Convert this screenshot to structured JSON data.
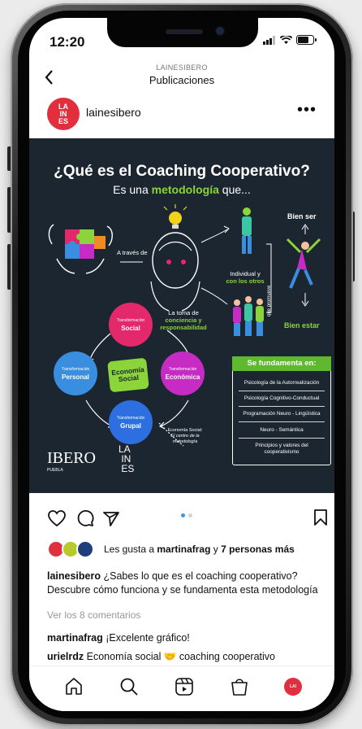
{
  "status": {
    "time": "12:20"
  },
  "nav": {
    "back_icon": "chevron-left-icon",
    "account": "LAINESIBERO",
    "title": "Publicaciones"
  },
  "post": {
    "avatar_text": "LA IN ES",
    "username": "lainesibero",
    "more_icon": "more-horizontal-icon"
  },
  "graphic": {
    "title": "¿Qué es el Coaching Cooperativo?",
    "subtitle_pre": "Es una ",
    "subtitle_highlight": "metodología",
    "subtitle_post": " que...",
    "a_traves": "A través de",
    "toma_1": "La toma de",
    "toma_2": "conciencia y",
    "toma_3": "responsabilidad",
    "individual": "Individual y",
    "con_otros": "con los otros",
    "promueve": "que promueve",
    "bien_ser": "Bien ser",
    "bien_estar": "Bien estar",
    "circles": {
      "social": {
        "pre": "Transformación",
        "main": "Social"
      },
      "personal": {
        "pre": "Transformación",
        "main": "Personal"
      },
      "economica": {
        "pre": "Transformación",
        "main": "Económica"
      },
      "grupal": {
        "pre": "Transformación",
        "main": "Grupal"
      },
      "economia": "Economía Social"
    },
    "eco_note_1": "Economía Social:",
    "eco_note_2": "El centro de la",
    "eco_note_3": "metodología",
    "fundamenta": "Se fundamenta en:",
    "fund_items": [
      "Psicología de la Autorrealización",
      "Psicología Cognitivo-Conductual",
      "Programación Neuro - Lingüística",
      "Neuro - Semántica",
      "Principios y valores del cooperativismo"
    ],
    "ibero": "IBERO",
    "puebla": "PUEBLA",
    "laines_logo": "LA IN ES",
    "colors": {
      "bg": "#1c2631",
      "green": "#8bd43a",
      "pink": "#e3286b",
      "blue": "#3a8ee0",
      "magenta": "#c62bc4",
      "bright_blue": "#2d6fe0"
    }
  },
  "actions": {
    "like_icon": "heart-icon",
    "comment_icon": "comment-icon",
    "share_icon": "send-icon",
    "save_icon": "bookmark-icon"
  },
  "likes": {
    "prefix": "Les gusta a ",
    "user": "martinafrag",
    "middle": " y ",
    "others": "7 personas más"
  },
  "caption": {
    "user": "lainesibero",
    "text": " ¿Sabes lo que es el coaching cooperativo? Descubre cómo funciona y se fundamenta esta metodología"
  },
  "view_comments": "Ver los 8 comentarios",
  "comments": [
    {
      "user": "martinafrag",
      "text": " ¡Excelente gráfico!"
    },
    {
      "user": "urielrdz",
      "text": " Economía social 🤝 coaching cooperativo"
    }
  ],
  "tabbar": {
    "home_icon": "home-icon",
    "search_icon": "search-icon",
    "reels_icon": "reels-icon",
    "shop_icon": "shop-bag-icon",
    "profile_icon": "profile-avatar-icon"
  }
}
